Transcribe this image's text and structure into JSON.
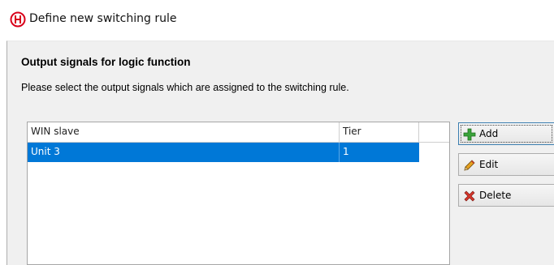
{
  "window": {
    "title": "Define new switching rule",
    "icon": "app-logo-icon"
  },
  "section": {
    "title": "Output signals for logic function",
    "description": "Please select the output signals which are assigned to the switching rule."
  },
  "table": {
    "columns": [
      "WIN slave",
      "Tier",
      ""
    ],
    "rows": [
      {
        "win_slave": "Unit 3",
        "tier": "1",
        "selected": true
      }
    ]
  },
  "buttons": {
    "add": {
      "label": "Add",
      "icon": "plus-icon"
    },
    "edit": {
      "label": "Edit",
      "icon": "pencil-icon"
    },
    "delete": {
      "label": "Delete",
      "icon": "delete-x-icon"
    }
  },
  "colors": {
    "selection": "#0078d7",
    "dialog_bg": "#f0f0f0",
    "app_icon": "#d9001b"
  }
}
